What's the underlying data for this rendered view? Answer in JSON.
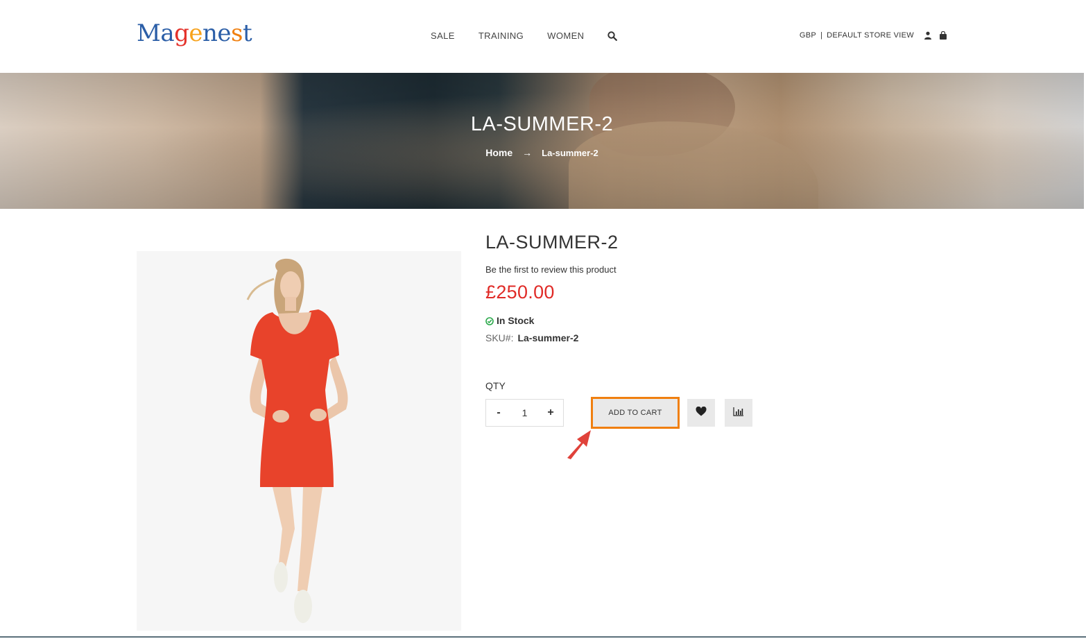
{
  "header": {
    "logo_letters": [
      "M",
      "a",
      "g",
      "e",
      "n",
      "e",
      "s",
      "t"
    ],
    "logo_colors": [
      "#2b5ea7",
      "#2b5ea7",
      "#e4322b",
      "#f7a21b",
      "#2b5ea7",
      "#2b5ea7",
      "#f07f0f",
      "#2b5ea7"
    ],
    "nav": [
      "SALE",
      "TRAINING",
      "WOMEN"
    ],
    "currency": "GBP",
    "separator": "|",
    "store_view": "DEFAULT STORE VIEW"
  },
  "banner": {
    "title": "LA-SUMMER-2",
    "breadcrumb_home": "Home",
    "breadcrumb_arrow": "→",
    "breadcrumb_current": "La-summer-2"
  },
  "product": {
    "name": "LA-SUMMER-2",
    "review_text": "Be the first to review this product",
    "price": "£250.00",
    "stock": "In Stock",
    "sku_label": "SKU#:",
    "sku_value": "La-summer-2",
    "qty_label": "QTY",
    "qty_minus": "-",
    "qty_value": "1",
    "qty_plus": "+",
    "add_to_cart": "ADD TO CART"
  },
  "colors": {
    "accent_orange": "#f07f0f",
    "price_red": "#e02b27",
    "stock_green": "#2aa84a",
    "annotation_arrow": "#e0423a"
  },
  "icons": {
    "search": "search-icon",
    "account": "user-icon",
    "cart": "shopping-bag-icon",
    "stock": "check-circle-icon",
    "wishlist": "heart-icon",
    "compare": "bar-chart-icon"
  }
}
